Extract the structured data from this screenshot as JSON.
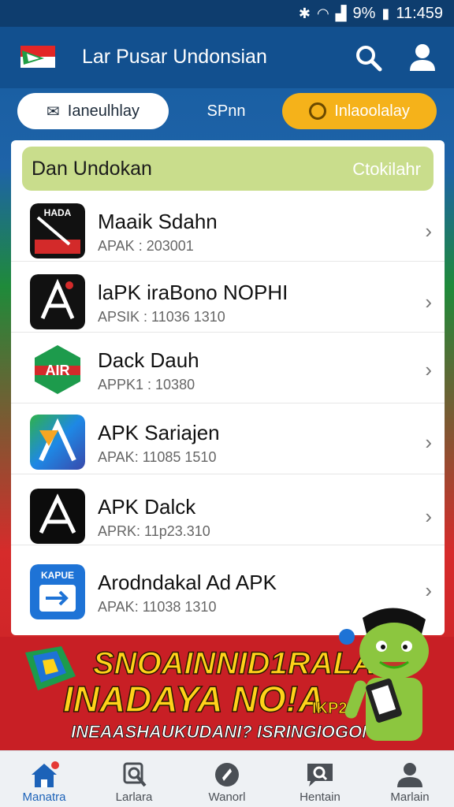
{
  "status_bar": {
    "battery": "9%",
    "time": "11:459"
  },
  "app_bar": {
    "title": "Lar Pusar Undonsian"
  },
  "tabs": [
    {
      "label": "Ianeulhlay"
    },
    {
      "label": "SPnn"
    },
    {
      "label": "Inlaoolalay"
    }
  ],
  "list_header": {
    "title": "Dan Undokan",
    "action": "Ctokilahr"
  },
  "apps": [
    {
      "name": "Maaik Sdahn",
      "sub": "APAK : 203001"
    },
    {
      "name": "laPK iraBono NOPHI",
      "sub": "APSIK : 11036 1310"
    },
    {
      "name": "Dack Dauh",
      "sub": "APPK1 : 10380"
    },
    {
      "name": "APK Sariajen",
      "sub": "APAK: 11085 1510"
    },
    {
      "name": "APK Dalck",
      "sub": "APRK: 11p23.310"
    },
    {
      "name": "Arodndakal Ad APK",
      "sub": "APAK: 11038 1310"
    }
  ],
  "app_icon_texts": {
    "icon1": "HADA",
    "icon3": "AIR",
    "icon6": "KAPUE"
  },
  "promo": {
    "line1": "SNOAINNID1RALA",
    "line2": "INADAYA NO!A",
    "line3": "INEAASHAUKUDANI? ISRINGIOGON",
    "badge": "IKP2N"
  },
  "bottom_nav": [
    {
      "label": "Manatra"
    },
    {
      "label": "Larlara"
    },
    {
      "label": "Wanorl"
    },
    {
      "label": "Hentain"
    },
    {
      "label": "Marlain"
    }
  ],
  "colors": {
    "primary": "#12508f",
    "accent": "#f5b21a",
    "header_green": "#c9dd8c",
    "promo_red": "#c81f25",
    "promo_yellow": "#ffd21a"
  }
}
